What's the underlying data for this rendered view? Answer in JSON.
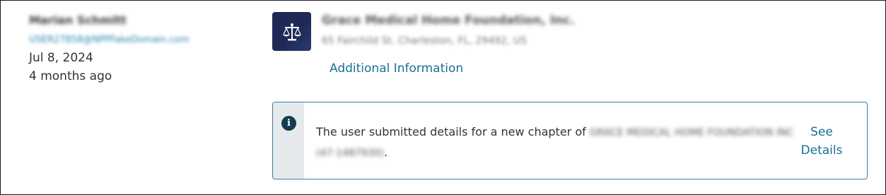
{
  "user": {
    "name": "Marian Schmitt",
    "email": "USER27858@NPPFakeDomain.com",
    "date": "Jul 8, 2024",
    "relative_time": "4 months ago"
  },
  "organization": {
    "logo_icon": "scales-of-justice-icon",
    "name": "Grace Medical Home Foundation, Inc.",
    "address": "65 Fairchild St. Charleston, FL, 29492, US",
    "additional_info_label": "Additional Information"
  },
  "notice": {
    "icon": "info-icon",
    "icon_glyph": "i",
    "message_prefix": "The user submitted details for a new chapter of ",
    "chapter_name": "GRACE MEDICAL HOME FOUNDATION INC (47-1487930)",
    "message_suffix": ".",
    "action_label": "See Details"
  },
  "colors": {
    "link": "#1a6f93",
    "logo_background": "#1e2a55",
    "notice_border": "#3a7da0",
    "notice_gutter": "#e6e9ec",
    "info_icon": "#123d52"
  }
}
